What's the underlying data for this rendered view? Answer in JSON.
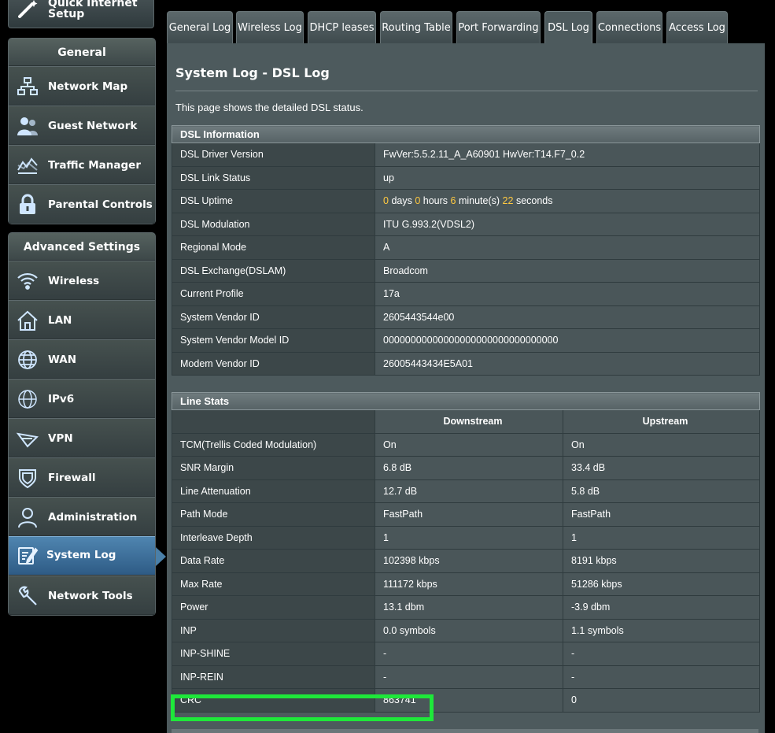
{
  "quick_setup": {
    "label_line1": "Quick Internet",
    "label_line2": "Setup"
  },
  "sidebar": {
    "general": {
      "title": "General",
      "items": [
        {
          "label": "Network Map",
          "icon": "network-map-icon"
        },
        {
          "label": "Guest Network",
          "icon": "guest-network-icon"
        },
        {
          "label": "Traffic Manager",
          "icon": "traffic-manager-icon"
        },
        {
          "label": "Parental Controls",
          "icon": "lock-icon"
        }
      ]
    },
    "advanced": {
      "title": "Advanced Settings",
      "items": [
        {
          "label": "Wireless",
          "icon": "wifi-icon"
        },
        {
          "label": "LAN",
          "icon": "home-icon"
        },
        {
          "label": "WAN",
          "icon": "globe-icon"
        },
        {
          "label": "IPv6",
          "icon": "ipv6-icon"
        },
        {
          "label": "VPN",
          "icon": "vpn-icon"
        },
        {
          "label": "Firewall",
          "icon": "shield-icon"
        },
        {
          "label": "Administration",
          "icon": "admin-user-icon"
        },
        {
          "label": "System Log",
          "icon": "system-log-icon",
          "active": true
        },
        {
          "label": "Network Tools",
          "icon": "tools-icon"
        }
      ]
    }
  },
  "tabs": [
    {
      "label": "General Log"
    },
    {
      "label": "Wireless Log"
    },
    {
      "label": "DHCP leases"
    },
    {
      "label": "Routing Table"
    },
    {
      "label": "Port Forwarding"
    },
    {
      "label": "DSL Log",
      "active": true
    },
    {
      "label": "Connections"
    },
    {
      "label": "Access Log"
    }
  ],
  "main": {
    "title": "System Log - DSL Log",
    "description": "This page shows the detailed DSL status."
  },
  "dsl_info": {
    "title": "DSL Information",
    "rows": [
      {
        "label": "DSL Driver Version",
        "value": "FwVer:5.5.2.11_A_A60901 HwVer:T14.F7_0.2"
      },
      {
        "label": "DSL Link Status",
        "value": "up"
      },
      {
        "label": "DSL Uptime",
        "value": ""
      },
      {
        "label": "DSL Modulation",
        "value": "ITU G.993.2(VDSL2)"
      },
      {
        "label": "Regional Mode",
        "value": "A"
      },
      {
        "label": "DSL Exchange(DSLAM)",
        "value": "Broadcom"
      },
      {
        "label": "Current Profile",
        "value": "17a"
      },
      {
        "label": "System Vendor ID",
        "value": "2605443544e00"
      },
      {
        "label": "System Vendor Model ID",
        "value": "00000000000000000000000000000000"
      },
      {
        "label": "Modem Vendor ID",
        "value": "26005443434E5A01"
      }
    ],
    "uptime": {
      "days": "0",
      "days_unit": "days",
      "hours": "0",
      "hours_unit": "hours",
      "minutes": "6",
      "minutes_unit": "minute(s)",
      "seconds": "22",
      "seconds_unit": "seconds",
      "highlight_color": "#ffc940"
    }
  },
  "line_stats": {
    "title": "Line Stats",
    "col_downstream": "Downstream",
    "col_upstream": "Upstream",
    "rows": [
      {
        "label": "TCM(Trellis Coded Modulation)",
        "down": "On",
        "up": "On"
      },
      {
        "label": "SNR Margin",
        "down": "6.8 dB",
        "up": "33.4 dB"
      },
      {
        "label": "Line Attenuation",
        "down": "12.7 dB",
        "up": "5.8 dB"
      },
      {
        "label": "Path Mode",
        "down": "FastPath",
        "up": "FastPath"
      },
      {
        "label": "Interleave Depth",
        "down": "1",
        "up": "1"
      },
      {
        "label": "Data Rate",
        "down": "102398 kbps",
        "up": "8191 kbps"
      },
      {
        "label": "Max Rate",
        "down": "111172 kbps",
        "up": "51286 kbps"
      },
      {
        "label": "Power",
        "down": "13.1 dbm",
        "up": "-3.9 dbm"
      },
      {
        "label": "INP",
        "down": "0.0 symbols",
        "up": "1.1 symbols"
      },
      {
        "label": "INP-SHINE",
        "down": "-",
        "up": "-"
      },
      {
        "label": "INP-REIN",
        "down": "-",
        "up": "-"
      },
      {
        "label": "CRC",
        "down": "863741",
        "up": "0"
      }
    ]
  },
  "colors": {
    "active_tab_bg": "#4d5a5d",
    "highlight_box": "#1ee83a",
    "active_menu": "#3f74a0"
  }
}
